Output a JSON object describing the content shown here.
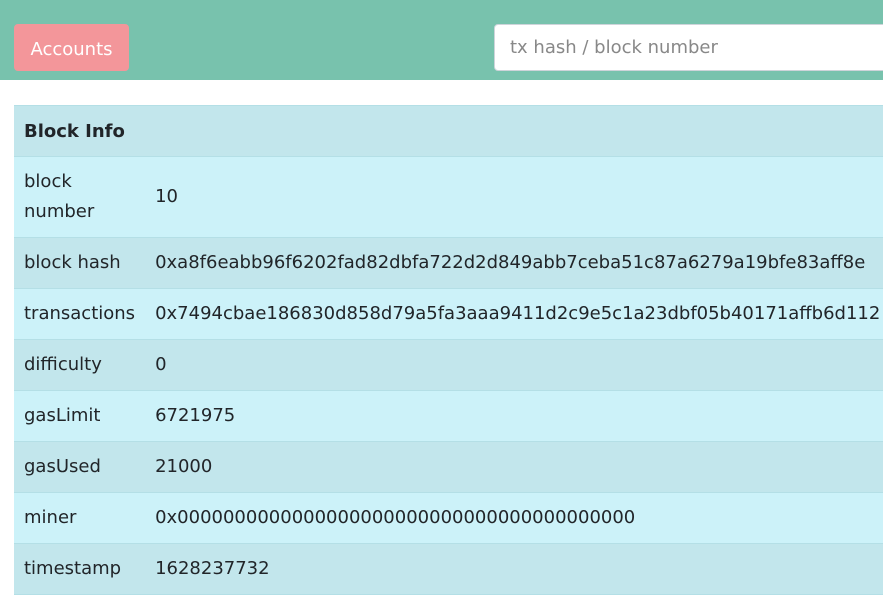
{
  "navbar": {
    "accounts_label": "Accounts",
    "search_placeholder": "tx hash / block number"
  },
  "block_info": {
    "title": "Block Info",
    "rows": [
      {
        "label": "block number",
        "value": "10"
      },
      {
        "label": "block hash",
        "value": "0xa8f6eabb96f6202fad82dbfa722d2d849abb7ceba51c87a6279a19bfe83aff8e"
      },
      {
        "label": "transactions",
        "value": "0x7494cbae186830d858d79a5fa3aaa9411d2c9e5c1a23dbf05b40171affb6d112"
      },
      {
        "label": "difficulty",
        "value": "0"
      },
      {
        "label": "gasLimit",
        "value": "6721975"
      },
      {
        "label": "gasUsed",
        "value": "21000"
      },
      {
        "label": "miner",
        "value": "0x0000000000000000000000000000000000000000"
      },
      {
        "label": "timestamp",
        "value": "1628237732"
      }
    ]
  },
  "colors": {
    "navbar_bg": "#78c2ad",
    "accounts_button_bg": "#f3969a",
    "row_light": "#ccf2f9",
    "row_dark": "#c2e6ec"
  }
}
